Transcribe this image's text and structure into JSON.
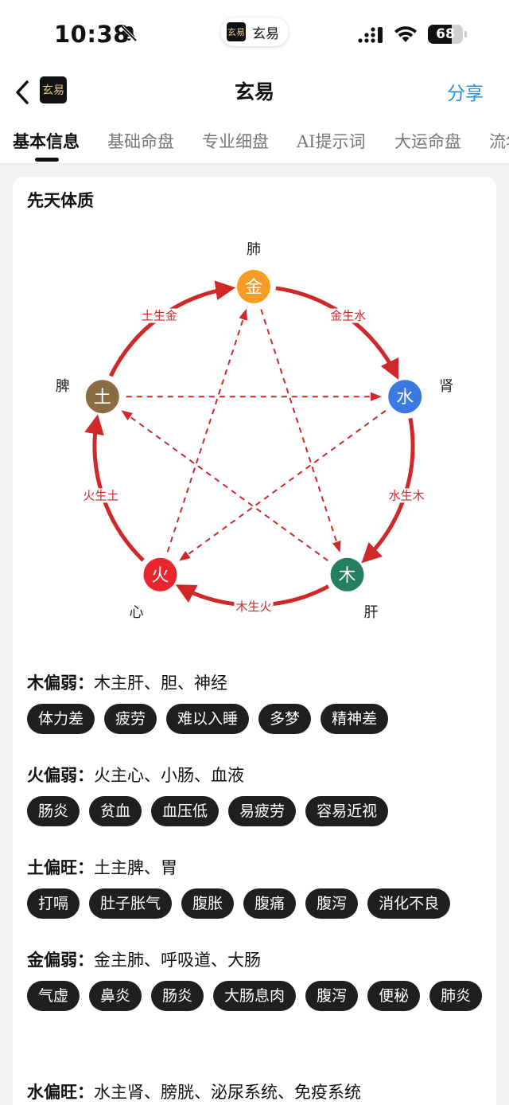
{
  "status_bar": {
    "time": "10:38",
    "mini_app_name": "玄易",
    "mini_app_logo": "玄易",
    "battery_level": 68,
    "battery_text": "68",
    "bell_icon": "bell-muted-icon"
  },
  "nav": {
    "logo_text": "玄易",
    "title": "玄易",
    "share_label": "分享"
  },
  "tabs": [
    {
      "label": "基本信息",
      "active": true
    },
    {
      "label": "基础命盘",
      "active": false
    },
    {
      "label": "专业细盘",
      "active": false
    },
    {
      "label": "AI提示词",
      "active": false
    },
    {
      "label": "大运命盘",
      "active": false
    },
    {
      "label": "流年",
      "active": false
    }
  ],
  "card": {
    "title": "先天体质"
  },
  "wheel": {
    "nodes": [
      {
        "element": "金",
        "organ": "肺",
        "color": "#f59d22"
      },
      {
        "element": "水",
        "organ": "肾",
        "color": "#3b79e2"
      },
      {
        "element": "木",
        "organ": "肝",
        "color": "#237f5f"
      },
      {
        "element": "火",
        "organ": "心",
        "color": "#e8252e"
      },
      {
        "element": "土",
        "organ": "脾",
        "color": "#8a6c42"
      }
    ],
    "generating_labels": [
      "金生水",
      "水生木",
      "木生火",
      "火生土",
      "土生金"
    ],
    "cycle_color": "#d02828"
  },
  "sections": [
    {
      "name": "木偏弱：",
      "desc": "木主肝、胆、神经",
      "tags": [
        "体力差",
        "疲劳",
        "难以入睡",
        "多梦",
        "精神差"
      ]
    },
    {
      "name": "火偏弱：",
      "desc": "火主心、小肠、血液",
      "tags": [
        "肠炎",
        "贫血",
        "血压低",
        "易疲劳",
        "容易近视"
      ]
    },
    {
      "name": "土偏旺：",
      "desc": "土主脾、胃",
      "tags": [
        "打嗝",
        "肚子胀气",
        "腹胀",
        "腹痛",
        "腹泻",
        "消化不良"
      ]
    },
    {
      "name": "金偏弱：",
      "desc": "金主肺、呼吸道、大肠",
      "tags": [
        "气虚",
        "鼻炎",
        "肠炎",
        "大肠息肉",
        "腹泻",
        "便秘",
        "肺炎"
      ]
    },
    {
      "name": "水偏旺：",
      "desc": "水主肾、膀胱、泌尿系统、免疫系统",
      "tags": []
    }
  ]
}
